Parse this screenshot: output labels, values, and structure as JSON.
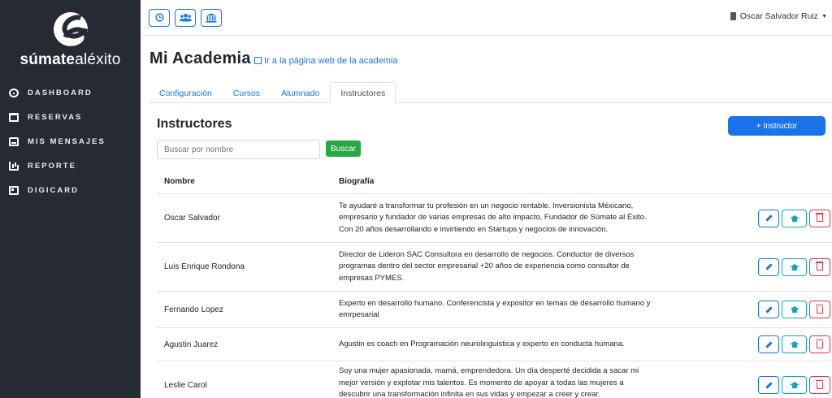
{
  "brand": {
    "bold": "súmate",
    "rest": "aléxito"
  },
  "nav": [
    {
      "label": "DASHBOARD",
      "icon": "dashboard-icon"
    },
    {
      "label": "RESERVAS",
      "icon": "calendar-icon"
    },
    {
      "label": "MIS MENSAJES",
      "icon": "inbox-icon"
    },
    {
      "label": "REPORTE",
      "icon": "chart-icon"
    },
    {
      "label": "DIGICARD",
      "icon": "id-card-icon"
    }
  ],
  "topbar": {
    "buttons": [
      "clock-icon",
      "users-icon",
      "institution-icon"
    ],
    "user_name": "Oscar Salvador Ruiz"
  },
  "page": {
    "title": "Mi Academia",
    "link_text": "Ir a la página web de la academia"
  },
  "tabs": [
    {
      "label": "Configuración",
      "active": false
    },
    {
      "label": "Cursos",
      "active": false
    },
    {
      "label": "Alumnado",
      "active": false
    },
    {
      "label": "Instructores",
      "active": true
    }
  ],
  "section": {
    "title": "Instructores",
    "add_button": "+ Instructor",
    "search_placeholder": "Buscar por nombre",
    "search_button": "Buscar"
  },
  "table": {
    "columns": [
      "Nombre",
      "Biografía"
    ],
    "rows": [
      {
        "name": "Oscar Salvador",
        "bio": "Te ayudaré a transformar tu profesión en un negocio rentable. Inversionista Méxicano, empresario y fundador de varias empresas de alto impacto, Fundador de Súmate al Éxito. Con 20 años desarrollando e invirtiendo en Startups y negocios de innovación."
      },
      {
        "name": "Luis Enrique Rondona",
        "bio": "Director de Lideron SAC Consultora en desarrollo de negocios. Conductor de diversos programas dentro del sector empresarial +20 años de experiencia como consultor de empresas PYMES."
      },
      {
        "name": "Fernando Lopez",
        "bio": "Experto en desarrollo humano. Conferencista y expositor en temas de desarrollo humano y emrpesarial"
      },
      {
        "name": "Agustin Juarez",
        "bio": "Agustin es coach en Programación neurolinguistica y experto en conducta humana."
      },
      {
        "name": "Leslie Carol",
        "bio": "Soy una mujer apasionada, mamá, emprendedora. Un día desperté decidida a sacar mi mejor versión y explotar mis talentos. Es momento de apoyar a todas las mujeres a descubrir una transformación infinita en sus vidas y empezar a creer y crear."
      }
    ]
  },
  "colors": {
    "sidebar_bg": "#252a33",
    "primary": "#1a73e8",
    "success": "#28a745",
    "info": "#17a2b8",
    "danger": "#dc3545"
  }
}
